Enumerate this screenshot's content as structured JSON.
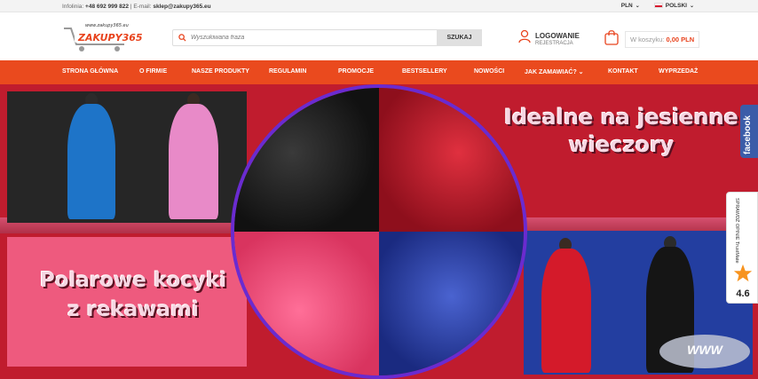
{
  "topbar": {
    "phone_label": "Infolinia:",
    "phone": "+48 692 999 822",
    "email_label": "E-mail:",
    "email": "sklep@zakupy365.eu",
    "currency": "PLN",
    "language": "POLSKI"
  },
  "header": {
    "logo_url_text": "www.zakupy365.eu",
    "search": {
      "placeholder": "Wyszukiwana fraza",
      "button": "SZUKAJ"
    },
    "login": {
      "title": "LOGOWANIE",
      "subtitle": "REJESTRACJA"
    },
    "cart": {
      "label": "W koszyku:",
      "amount": "0,00 PLN"
    }
  },
  "nav": [
    "STRONA GŁÓWNA",
    "O FIRMIE",
    "NASZE PRODUKTY",
    "REGULAMIN",
    "PROMOCJE",
    "BESTSELLERY",
    "NOWOŚCI",
    "JAK ZAMAWIAĆ?",
    "KONTAKT",
    "WYPRZEDAŻ"
  ],
  "banner": {
    "headline_right_1": "Idealne na jesienne",
    "headline_right_2": "wieczory",
    "headline_left_1": "Polarowe kocyki",
    "headline_left_2": "z rekawami",
    "colors": {
      "black": "#1a1a1a",
      "red": "#c8172e",
      "pink": "#f2457a",
      "blue": "#2a3fa8"
    }
  },
  "widgets": {
    "facebook": "facebook",
    "trust_label": "SPRAWDŹ OPINIE",
    "trust_brand": "TrustMate",
    "trust_score": "4.6",
    "www_badge": "WWW"
  }
}
